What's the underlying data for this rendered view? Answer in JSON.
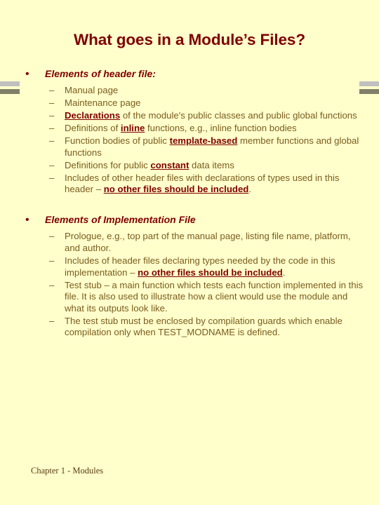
{
  "slide": {
    "background_color": "#FFFFCC",
    "title": "What goes in a Module’s Files?",
    "title_color": "#800000",
    "body_color": "#7a5c1e",
    "emphasis_color": "#800000",
    "bullet_glyph": "•",
    "dash_glyph": "–",
    "footer": "Chapter 1 - Modules",
    "decoration": {
      "bar_light_color": "#C0C0C0",
      "bar_dark_color": "#808069"
    }
  },
  "sections": [
    {
      "heading": "Elements of header file:",
      "items": [
        {
          "parts": [
            {
              "text": "Manual page",
              "emphasis": false
            }
          ]
        },
        {
          "parts": [
            {
              "text": "Maintenance page",
              "emphasis": false
            }
          ]
        },
        {
          "parts": [
            {
              "text": "Declarations",
              "emphasis": true
            },
            {
              "text": " of the module's public classes and public global functions",
              "emphasis": false
            }
          ]
        },
        {
          "parts": [
            {
              "text": "Definitions of ",
              "emphasis": false
            },
            {
              "text": "inline",
              "emphasis": true
            },
            {
              "text": " functions, e.g., inline function bodies",
              "emphasis": false
            }
          ]
        },
        {
          "parts": [
            {
              "text": "Function bodies of public ",
              "emphasis": false
            },
            {
              "text": "template-based",
              "emphasis": true
            },
            {
              "text": " member functions and global functions",
              "emphasis": false
            }
          ]
        },
        {
          "parts": [
            {
              "text": "Definitions for public ",
              "emphasis": false
            },
            {
              "text": "constant",
              "emphasis": true
            },
            {
              "text": " data items",
              "emphasis": false
            }
          ]
        },
        {
          "parts": [
            {
              "text": "Includes of other header files with declarations of types used in this header – ",
              "emphasis": false
            },
            {
              "text": "no other files should be included",
              "emphasis": true
            },
            {
              "text": ".",
              "emphasis": false
            }
          ]
        }
      ]
    },
    {
      "heading": "Elements of Implementation File",
      "items": [
        {
          "parts": [
            {
              "text": "Prologue, e.g., top part of the manual page, listing file name, platform, and author.",
              "emphasis": false
            }
          ]
        },
        {
          "parts": [
            {
              "text": "Includes of header files declaring types needed by the code in this implementation – ",
              "emphasis": false
            },
            {
              "text": "no other files should be included",
              "emphasis": true
            },
            {
              "text": ".",
              "emphasis": false
            }
          ]
        },
        {
          "parts": [
            {
              "text": "Test stub – a main function which tests each function implemented in this file.  It is also used to illustrate how a client would use the module and what its outputs look like.",
              "emphasis": false
            }
          ]
        },
        {
          "parts": [
            {
              "text": "The test stub must be enclosed by compilation guards which enable compilation only when TEST_MODNAME is defined.",
              "emphasis": false
            }
          ]
        }
      ]
    }
  ]
}
